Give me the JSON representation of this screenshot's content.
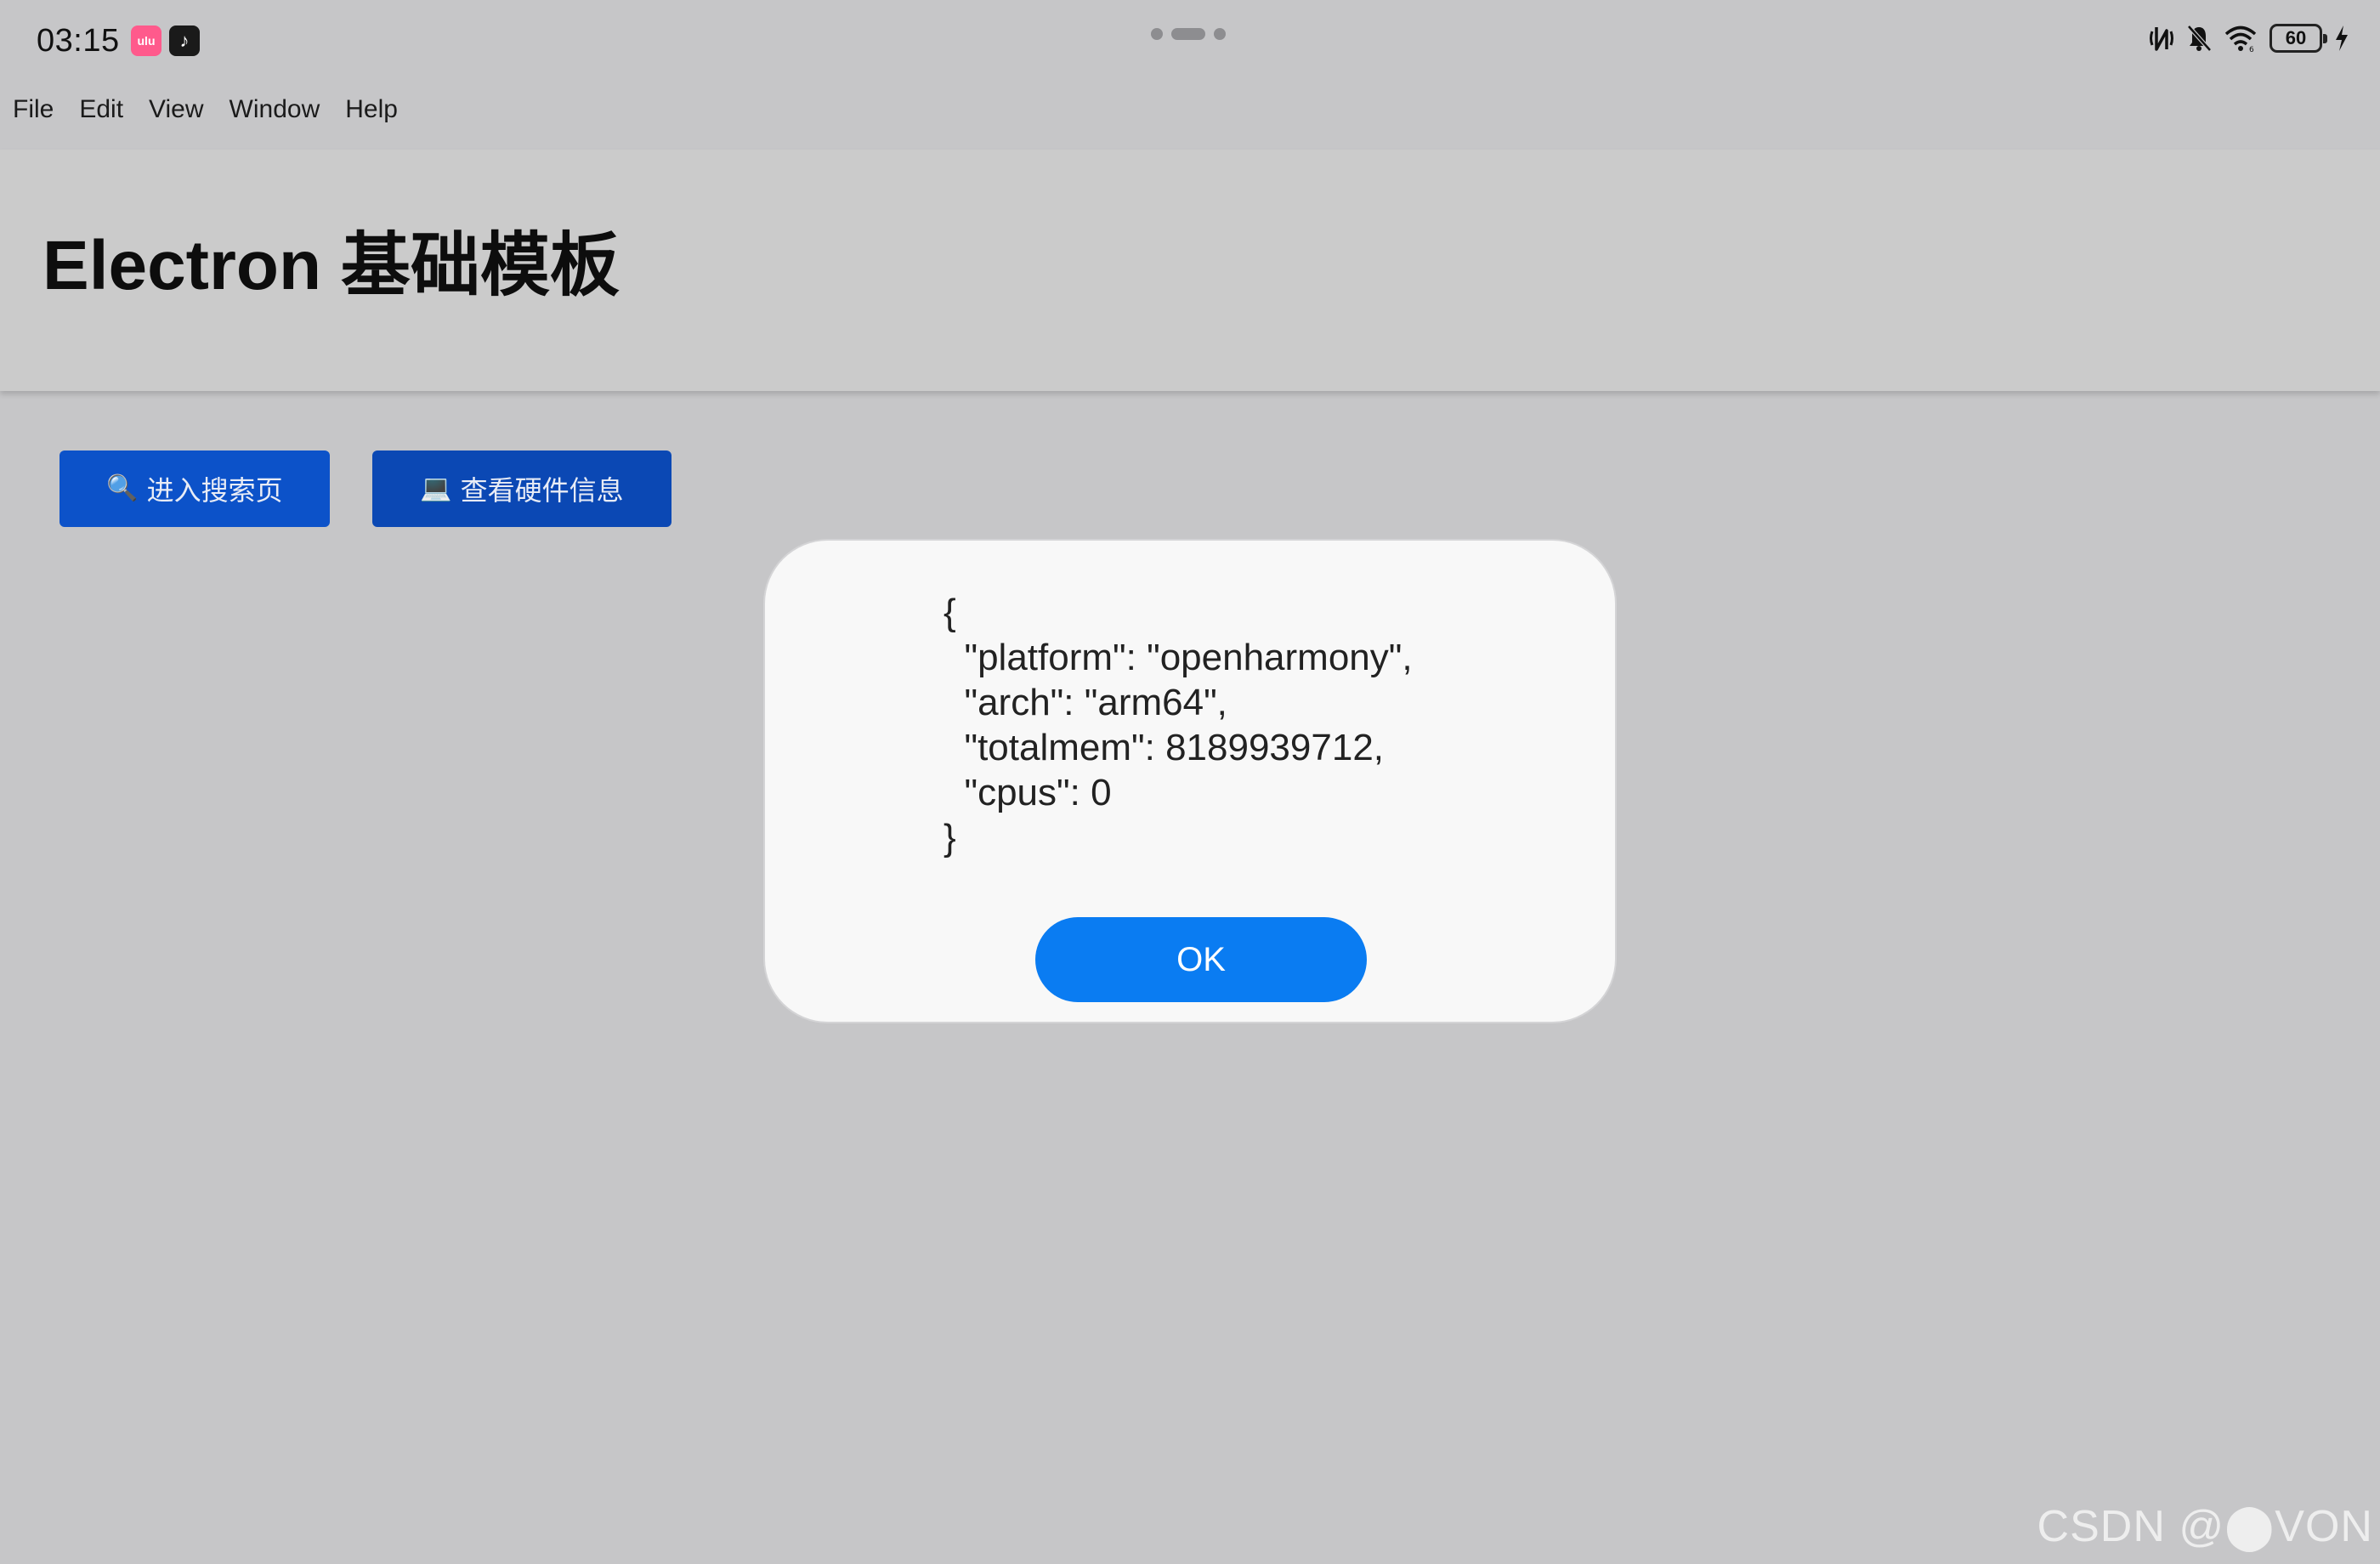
{
  "status_bar": {
    "time": "03:15",
    "apps": [
      {
        "icon": "video-app-icon",
        "label": "ulu"
      },
      {
        "icon": "tiktok-icon",
        "label": "♪"
      }
    ],
    "battery_level": "60",
    "icons": [
      "nfc-icon",
      "mute-bell-icon",
      "wifi-icon",
      "battery-icon",
      "charging-bolt-icon"
    ]
  },
  "menu": {
    "items": [
      "File",
      "Edit",
      "View",
      "Window",
      "Help"
    ]
  },
  "header": {
    "title": "Electron 基础模板"
  },
  "actions": {
    "search": {
      "icon": "🔍",
      "label": "进入搜索页"
    },
    "hardware": {
      "icon": "💻",
      "label": "查看硬件信息"
    }
  },
  "dialog": {
    "message": "{\n  \"platform\": \"openharmony\",\n  \"arch\": \"arm64\",\n  \"totalmem\": 8189939712,\n  \"cpus\": 0\n}",
    "ok_label": "OK"
  },
  "colors": {
    "primary_button": "#0c52c9",
    "dialog_ok": "#0a7cf2",
    "background": "#c6c6c8"
  },
  "watermark": "CSDN @⬤VON"
}
